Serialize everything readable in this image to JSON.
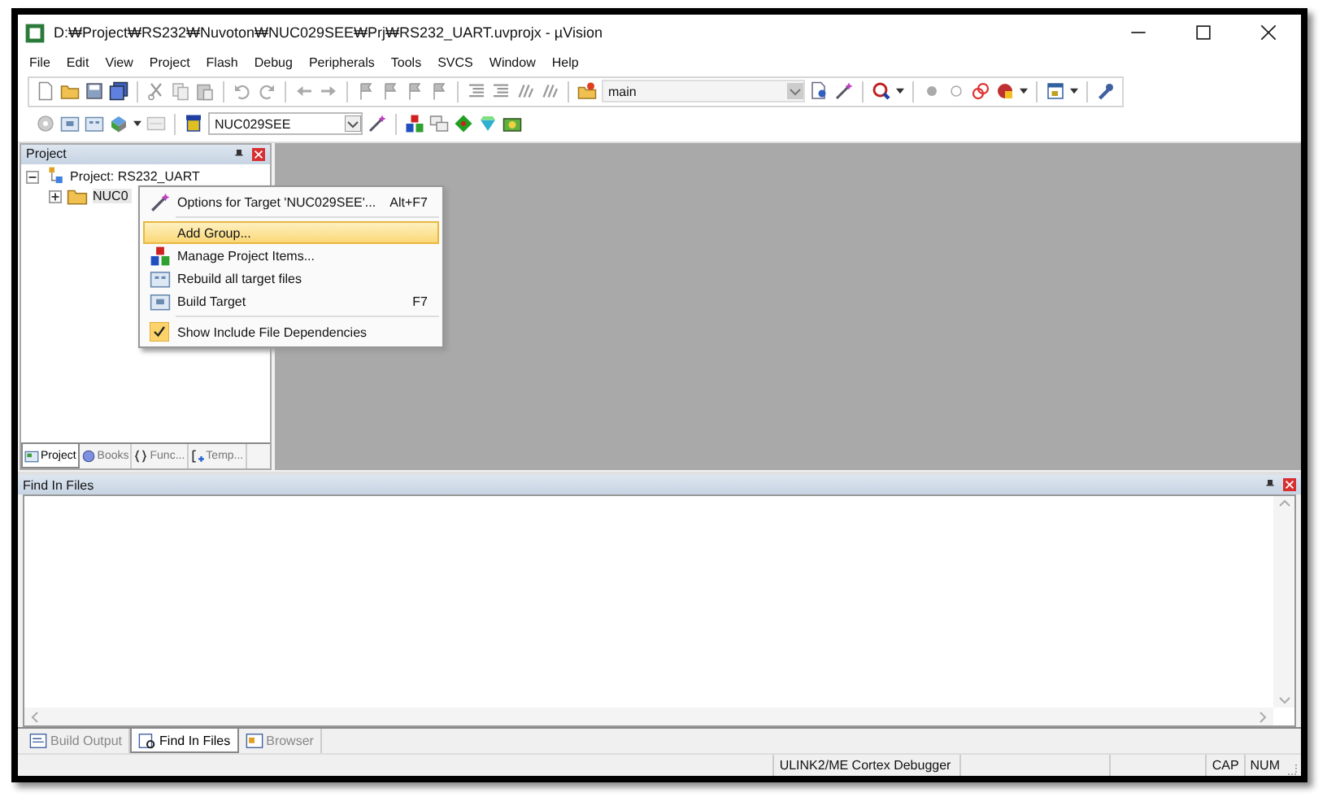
{
  "window": {
    "title": "D:₩Project₩RS232₩Nuvoton₩NUC029SEE₩Prj₩RS232_UART.uvprojx - µVision"
  },
  "menu": [
    "File",
    "Edit",
    "View",
    "Project",
    "Flash",
    "Debug",
    "Peripherals",
    "Tools",
    "SVCS",
    "Window",
    "Help"
  ],
  "toolbar": {
    "function_box": "main",
    "target_box": "NUC029SEE"
  },
  "project_panel": {
    "title": "Project",
    "tree": [
      {
        "label": "Project: RS232_UART",
        "expanded": true,
        "children": [
          {
            "label": "NUC0",
            "expanded": false
          }
        ]
      }
    ],
    "tabs": [
      {
        "label": "Project",
        "selected": true
      },
      {
        "label": "Books",
        "selected": false
      },
      {
        "label": "Func...",
        "selected": false
      },
      {
        "label": "Temp...",
        "selected": false
      }
    ]
  },
  "context_menu": {
    "items": [
      {
        "label": "Options for Target 'NUC029SEE'...",
        "shortcut": "Alt+F7",
        "highlighted": false,
        "checked": false,
        "separator_after": true
      },
      {
        "label": "Add Group...",
        "highlighted": true,
        "checked": false,
        "separator_after": false
      },
      {
        "label": "Manage Project Items...",
        "highlighted": false,
        "checked": false,
        "separator_after": false
      },
      {
        "label": "Rebuild all target files",
        "highlighted": false,
        "checked": false,
        "separator_after": false
      },
      {
        "label": "Build Target",
        "shortcut": "F7",
        "highlighted": false,
        "checked": false,
        "separator_after": true
      },
      {
        "label": "Show Include File Dependencies",
        "highlighted": false,
        "checked": true,
        "separator_after": false
      }
    ]
  },
  "find_panel": {
    "title": "Find In Files"
  },
  "bottom_tabs": [
    {
      "label": "Build Output",
      "selected": false
    },
    {
      "label": "Find In Files",
      "selected": true
    },
    {
      "label": "Browser",
      "selected": false
    }
  ],
  "status_bar": {
    "debugger": "ULINK2/ME Cortex Debugger",
    "caps": "CAP",
    "num": "NUM"
  }
}
